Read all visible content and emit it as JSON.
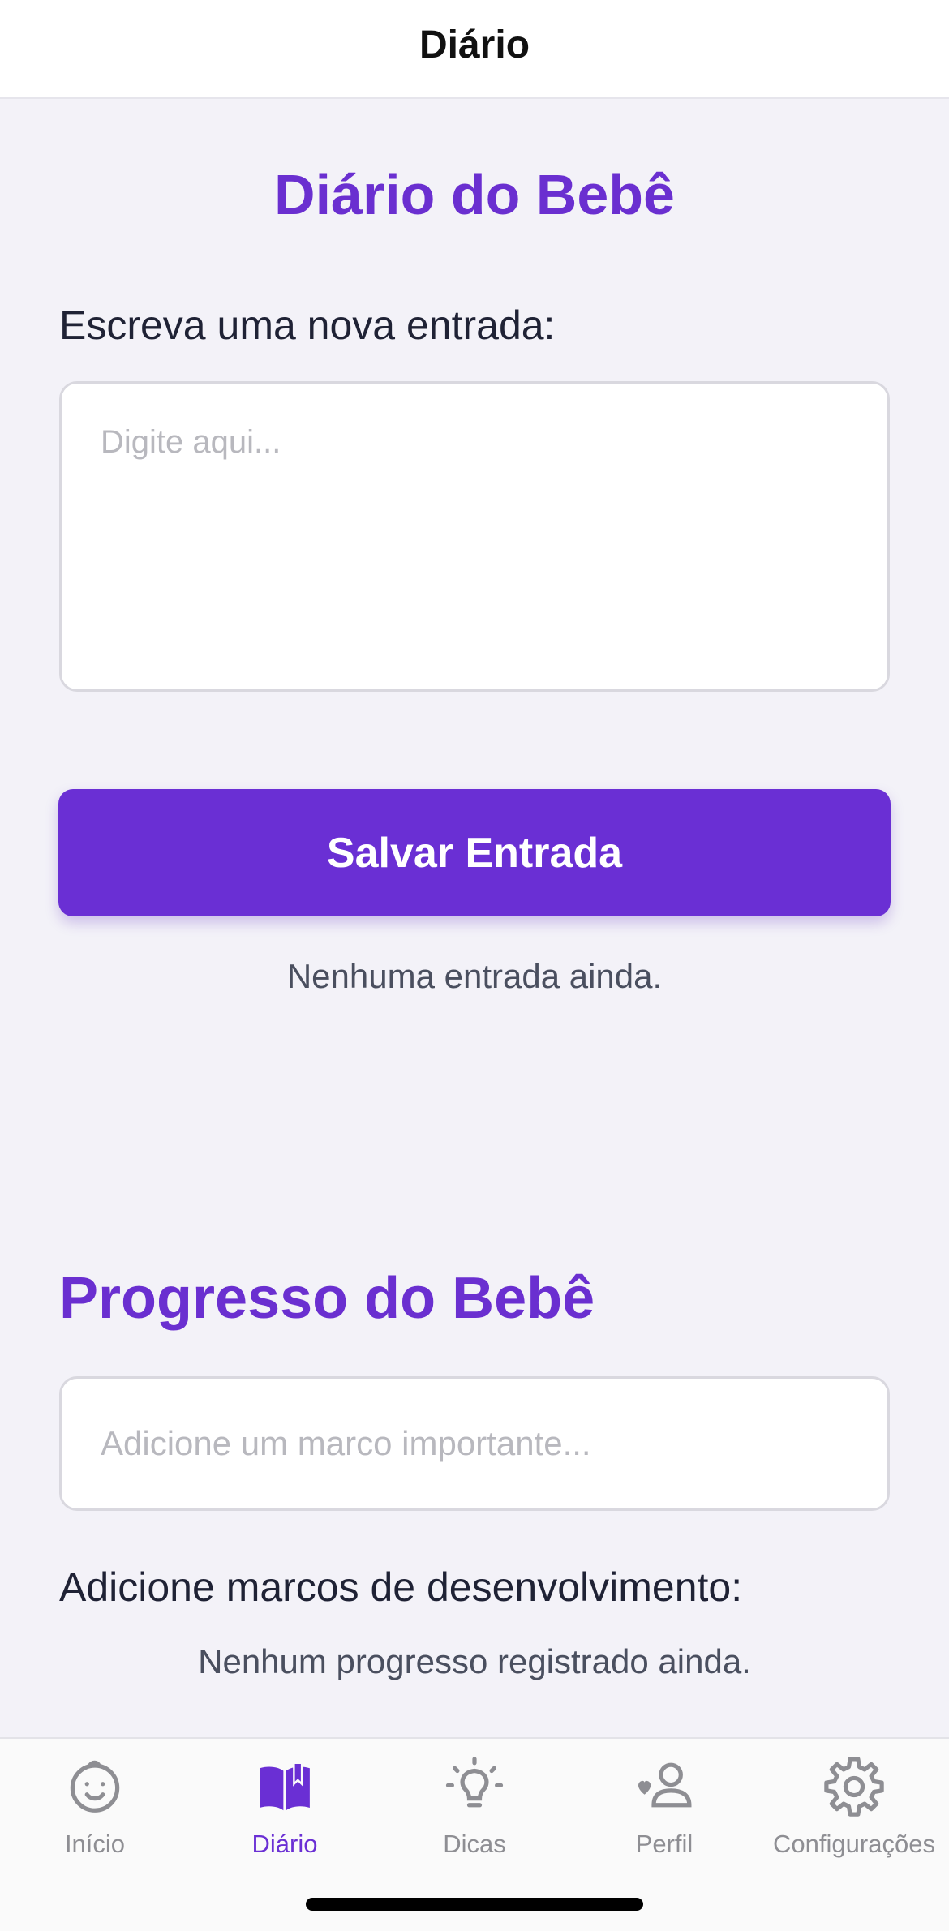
{
  "nav": {
    "title": "Diário"
  },
  "diary": {
    "title": "Diário do Bebê",
    "prompt_label": "Escreva uma nova entrada:",
    "textarea_placeholder": "Digite aqui...",
    "save_button": "Salvar Entrada",
    "empty_text": "Nenhuma entrada ainda."
  },
  "progress": {
    "title": "Progresso do Bebê",
    "input_placeholder": "Adicione um marco importante...",
    "label": "Adicione marcos de desenvolvimento:",
    "empty_text": "Nenhum progresso registrado ainda."
  },
  "tabs": [
    {
      "label": "Início",
      "icon": "baby-face-icon",
      "active": false
    },
    {
      "label": "Diário",
      "icon": "open-book-icon",
      "active": true
    },
    {
      "label": "Dicas",
      "icon": "lightbulb-icon",
      "active": false
    },
    {
      "label": "Perfil",
      "icon": "profile-heart-icon",
      "active": false
    },
    {
      "label": "Configurações",
      "icon": "gear-icon",
      "active": false
    }
  ],
  "colors": {
    "accent": "#6a2fd4",
    "inactive": "#8e8e93",
    "background": "#f3f2f8"
  }
}
